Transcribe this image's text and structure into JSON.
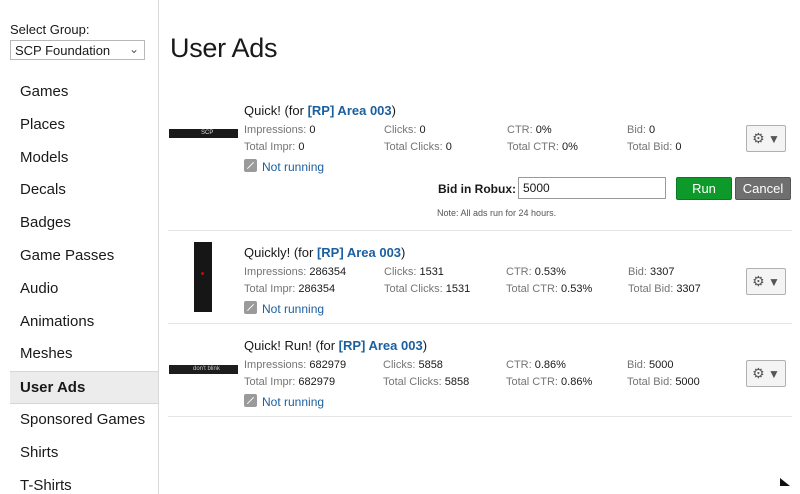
{
  "sidebar": {
    "group_label": "Select Group:",
    "group_value": "SCP Foundation",
    "items": [
      {
        "label": "Games"
      },
      {
        "label": "Places"
      },
      {
        "label": "Models"
      },
      {
        "label": "Decals"
      },
      {
        "label": "Badges"
      },
      {
        "label": "Game Passes"
      },
      {
        "label": "Audio"
      },
      {
        "label": "Animations"
      },
      {
        "label": "Meshes"
      },
      {
        "label": "User Ads",
        "active": true
      },
      {
        "label": "Sponsored Games"
      },
      {
        "label": "Shirts"
      },
      {
        "label": "T-Shirts"
      }
    ]
  },
  "page_title": "User Ads",
  "ads": [
    {
      "name_prefix": "Quick! (for ",
      "name_link": "[RP] Area 003",
      "name_suffix": ")",
      "thumb_text": "SCP",
      "impressions_label": "Impressions:",
      "impressions": "0",
      "total_impr_label": "Total Impr:",
      "total_impr": "0",
      "clicks_label": "Clicks:",
      "clicks": "0",
      "total_clicks_label": "Total Clicks:",
      "total_clicks": "0",
      "ctr_label": "CTR:",
      "ctr": "0%",
      "total_ctr_label": "Total CTR:",
      "total_ctr": "0%",
      "bid_label": "Bid:",
      "bid": "0",
      "total_bid_label": "Total Bid:",
      "total_bid": "0",
      "status": "Not running"
    },
    {
      "name_prefix": "Quickly! (for ",
      "name_link": "[RP] Area 003",
      "name_suffix": ")",
      "impressions_label": "Impressions:",
      "impressions": "286354",
      "total_impr_label": "Total Impr:",
      "total_impr": "286354",
      "clicks_label": "Clicks:",
      "clicks": "1531",
      "total_clicks_label": "Total Clicks:",
      "total_clicks": "1531",
      "ctr_label": "CTR:",
      "ctr": "0.53%",
      "total_ctr_label": "Total CTR:",
      "total_ctr": "0.53%",
      "bid_label": "Bid:",
      "bid": "3307",
      "total_bid_label": "Total Bid:",
      "total_bid": "3307",
      "status": "Not running"
    },
    {
      "name_prefix": "Quick! Run! (for ",
      "name_link": "[RP] Area 003",
      "name_suffix": ")",
      "thumb_text": "don't blink",
      "impressions_label": "Impressions:",
      "impressions": "682979",
      "total_impr_label": "Total Impr:",
      "total_impr": "682979",
      "clicks_label": "Clicks:",
      "clicks": "5858",
      "total_clicks_label": "Total Clicks:",
      "total_clicks": "5858",
      "ctr_label": "CTR:",
      "ctr": "0.86%",
      "total_ctr_label": "Total CTR:",
      "total_ctr": "0.86%",
      "bid_label": "Bid:",
      "bid": "5000",
      "total_bid_label": "Total Bid:",
      "total_bid": "5000",
      "status": "Not running"
    }
  ],
  "bid_form": {
    "label": "Bid in Robux:",
    "value": "5000",
    "run_label": "Run",
    "cancel_label": "Cancel",
    "note": "Note: All ads run for 24 hours."
  },
  "icons": {
    "gear": "gear-icon",
    "caret": "caret-down-icon",
    "not_running": "not-running-icon"
  },
  "colors": {
    "link": "#1b5f9f",
    "run_button": "#0e9a2a",
    "cancel_button": "#6f6f6f"
  }
}
